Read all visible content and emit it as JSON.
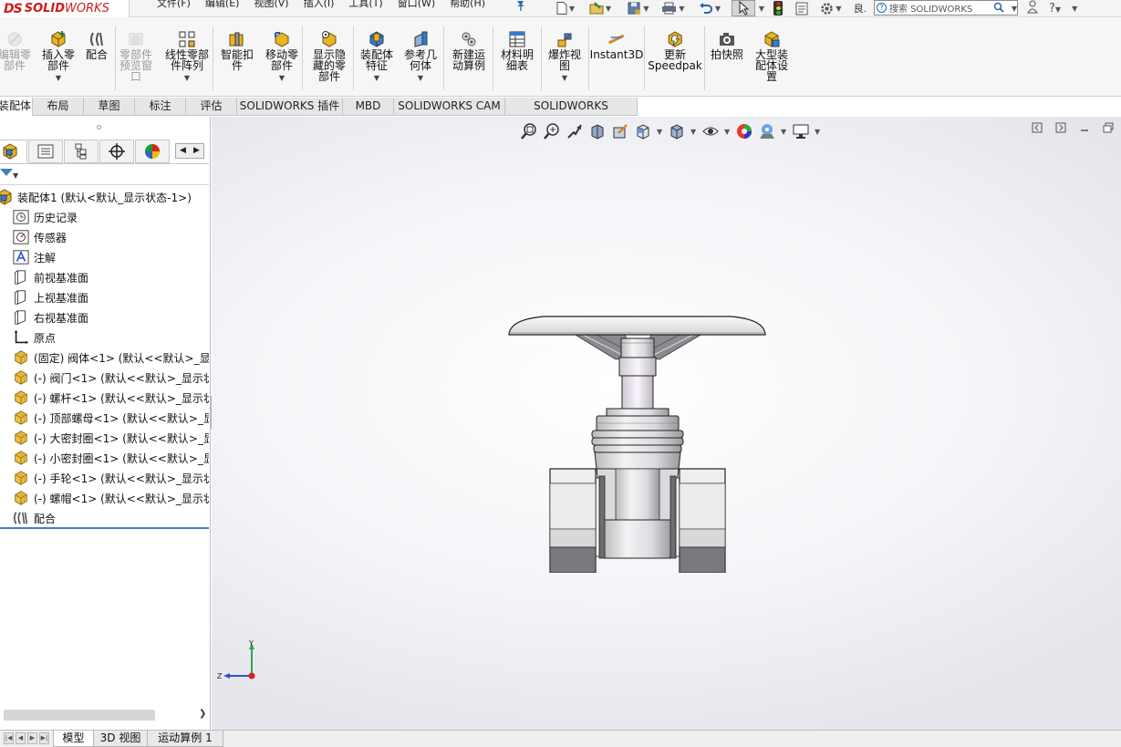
{
  "app": {
    "brand_prefix": "DS",
    "brand_name_bold": "SOLID",
    "brand_name_thin": "WORKS"
  },
  "menu": [
    "文件(F)",
    "编辑(E)",
    "视图(V)",
    "插入(I)",
    "工具(T)",
    "窗口(W)",
    "帮助(H)"
  ],
  "quick_access": {
    "new_icon": "new-document-icon",
    "open_icon": "open-folder-icon",
    "save_icon": "save-icon",
    "print_icon": "print-icon",
    "undo_icon": "undo-icon",
    "select_icon": "select-arrow-icon",
    "rebuild_icon": "rebuild-traffic-light-icon",
    "file_props_icon": "file-properties-icon",
    "options_icon": "options-gear-icon",
    "overflow_text": "良."
  },
  "search": {
    "placeholder": "搜索 SOLIDWORKS"
  },
  "ribbon": [
    {
      "label": "编辑零\n部件",
      "icon": "edit-component-icon",
      "disabled": true,
      "arrow": false
    },
    {
      "label": "插入零\n部件",
      "icon": "insert-component-icon",
      "disabled": false,
      "arrow": true
    },
    {
      "label": "配合",
      "icon": "mate-icon",
      "disabled": false,
      "arrow": false
    },
    {
      "label": "零部件\n预览窗\n口",
      "icon": "component-preview-icon",
      "disabled": true,
      "arrow": false
    },
    {
      "label": "线性零部\n件阵列",
      "icon": "linear-pattern-icon",
      "disabled": false,
      "arrow": true
    },
    {
      "label": "智能扣\n件",
      "icon": "smart-fastener-icon",
      "disabled": false,
      "arrow": false
    },
    {
      "label": "移动零\n部件",
      "icon": "move-component-icon",
      "disabled": false,
      "arrow": true
    },
    {
      "label": "显示隐\n藏的零\n部件",
      "icon": "show-hidden-icon",
      "disabled": false,
      "arrow": false
    },
    {
      "label": "装配体\n特征",
      "icon": "assembly-feature-icon",
      "disabled": false,
      "arrow": true
    },
    {
      "label": "参考几\n何体",
      "icon": "reference-geometry-icon",
      "disabled": false,
      "arrow": true
    },
    {
      "label": "新建运\n动算例",
      "icon": "new-motion-study-icon",
      "disabled": false,
      "arrow": false
    },
    {
      "label": "材料明\n细表",
      "icon": "bill-of-materials-icon",
      "disabled": false,
      "arrow": false
    },
    {
      "label": "爆炸视\n图",
      "icon": "exploded-view-icon",
      "disabled": false,
      "arrow": true
    },
    {
      "label": "Instant3D",
      "icon": "instant3d-icon",
      "disabled": false,
      "arrow": false
    },
    {
      "label": "更新\nSpeedpak",
      "icon": "speedpak-icon",
      "disabled": false,
      "arrow": false
    },
    {
      "label": "拍快照",
      "icon": "snapshot-camera-icon",
      "disabled": false,
      "arrow": false
    },
    {
      "label": "大型装\n配体设\n置",
      "icon": "large-assembly-icon",
      "disabled": false,
      "arrow": false
    }
  ],
  "tabs": [
    "装配体",
    "布局",
    "草图",
    "标注",
    "评估",
    "SOLIDWORKS 插件",
    "MBD",
    "SOLIDWORKS CAM",
    "SOLIDWORKS Inspection"
  ],
  "feature_tree": {
    "root": "装配体1  (默认<默认_显示状态-1>)",
    "items": [
      {
        "label": "历史记录",
        "icon": "history-icon"
      },
      {
        "label": "传感器",
        "icon": "sensor-icon"
      },
      {
        "label": "注解",
        "icon": "annotation-icon"
      },
      {
        "label": "前视基准面",
        "icon": "plane-icon"
      },
      {
        "label": "上视基准面",
        "icon": "plane-icon"
      },
      {
        "label": "右视基准面",
        "icon": "plane-icon"
      },
      {
        "label": "原点",
        "icon": "origin-icon"
      },
      {
        "label": "(固定) 阀体<1> (默认<<默认>_显示",
        "icon": "part-icon"
      },
      {
        "label": "(-) 阀门<1> (默认<<默认>_显示状",
        "icon": "part-icon"
      },
      {
        "label": "(-) 螺杆<1> (默认<<默认>_显示状",
        "icon": "part-icon"
      },
      {
        "label": "(-) 顶部螺母<1> (默认<<默认>_显",
        "icon": "part-icon"
      },
      {
        "label": "(-) 大密封圈<1> (默认<<默认>_显",
        "icon": "part-icon"
      },
      {
        "label": "(-) 小密封圈<1> (默认<<默认>_显",
        "icon": "part-icon"
      },
      {
        "label": "(-) 手轮<1> (默认<<默认>_显示状",
        "icon": "part-icon"
      },
      {
        "label": "(-) 螺帽<1> (默认<<默认>_显示状",
        "icon": "part-icon"
      },
      {
        "label": "配合",
        "icon": "mates-folder-icon"
      }
    ]
  },
  "triad": {
    "y_label": "Y",
    "z_label": "Z"
  },
  "bottom_tabs": [
    "模型",
    "3D 视图",
    "运动算例 1"
  ]
}
